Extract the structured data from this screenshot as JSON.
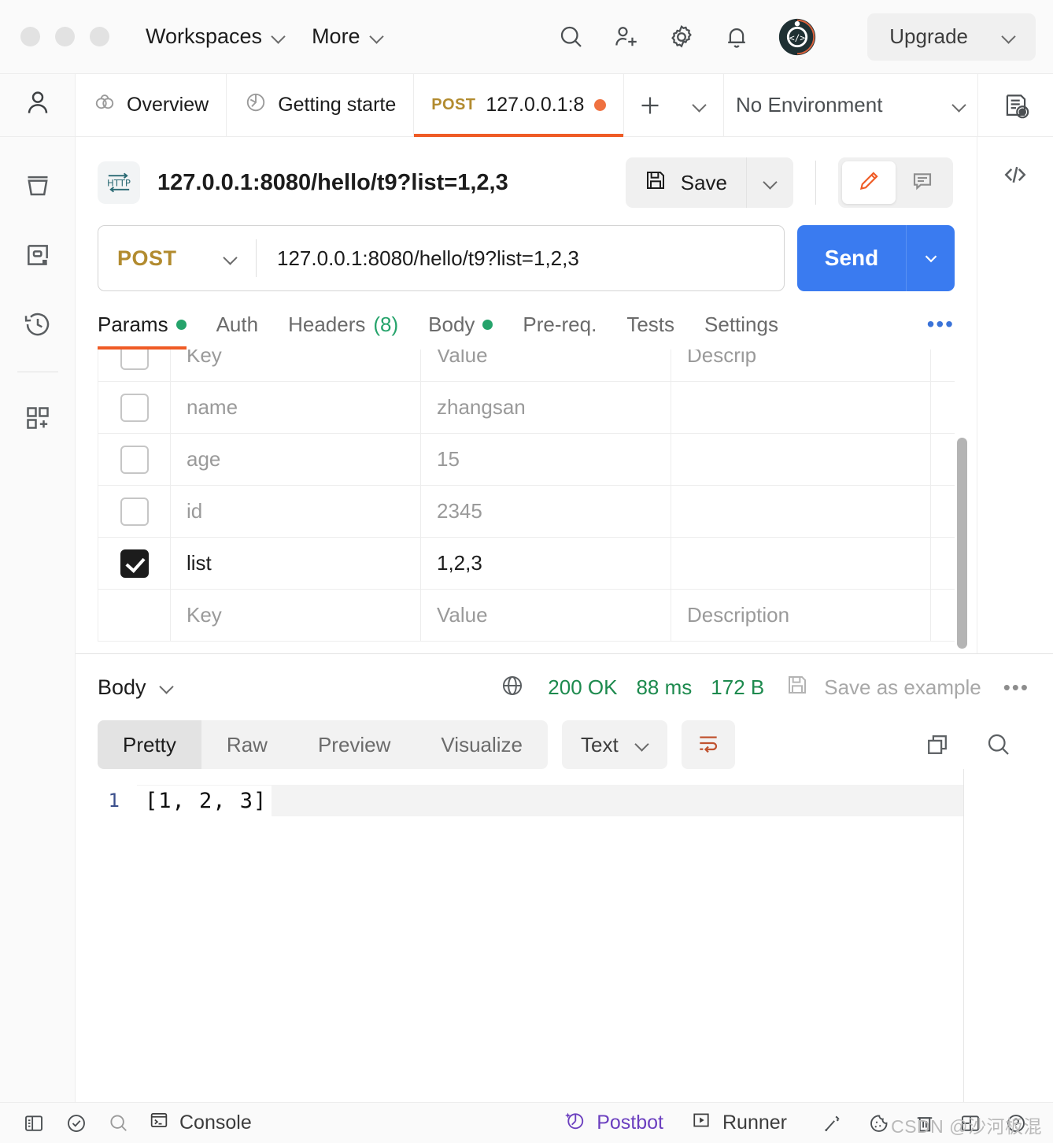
{
  "titlebar": {
    "workspaces_label": "Workspaces",
    "more_label": "More",
    "upgrade_label": "Upgrade",
    "icons": [
      "search-icon",
      "invite-user-icon",
      "settings-gear-icon",
      "notifications-bell-icon",
      "postman-logo-icon"
    ]
  },
  "sidebar": {
    "items": [
      {
        "name": "profile-avatar",
        "icon": "person-icon"
      },
      {
        "name": "collections",
        "icon": "collections-icon"
      },
      {
        "name": "apis",
        "icon": "api-box-icon"
      },
      {
        "name": "history",
        "icon": "history-clock-icon"
      },
      {
        "name": "new-module",
        "icon": "grid-plus-icon"
      }
    ]
  },
  "tabs": [
    {
      "label": "Overview",
      "icon": "overview-icon",
      "active": false
    },
    {
      "label": "Getting starte",
      "icon": "getting-started-icon",
      "active": false
    },
    {
      "label": "127.0.0.1:8",
      "method": "POST",
      "active": true,
      "unsaved": true
    }
  ],
  "tabbar": {
    "new_tab_label": "+",
    "environment": "No Environment",
    "env_icon": "environment-quick-look-icon"
  },
  "request": {
    "title": "127.0.0.1:8080/hello/t9?list=1,2,3",
    "protocol_badge": "HTTP",
    "save_label": "Save",
    "method": "POST",
    "url": "127.0.0.1:8080/hello/t9?list=1,2,3",
    "send_label": "Send",
    "edit_icon": "pencil-icon",
    "comment_icon": "comment-icon",
    "tabs": [
      {
        "label": "Params",
        "dot": true,
        "active": true
      },
      {
        "label": "Auth",
        "dot": false,
        "active": false
      },
      {
        "label": "Headers",
        "count": "(8)",
        "active": false
      },
      {
        "label": "Body",
        "dot": true,
        "active": false
      },
      {
        "label": "Pre-req.",
        "active": false
      },
      {
        "label": "Tests",
        "active": false
      },
      {
        "label": "Settings",
        "active": false
      }
    ]
  },
  "params": {
    "columns": [
      "Key",
      "Value",
      "Descrip"
    ],
    "placeholders": {
      "key": "Key",
      "value": "Value",
      "description": "Description"
    },
    "rows": [
      {
        "checked": false,
        "key": "name",
        "value": "zhangsan",
        "description": ""
      },
      {
        "checked": false,
        "key": "age",
        "value": "15",
        "description": ""
      },
      {
        "checked": false,
        "key": "id",
        "value": "2345",
        "description": ""
      },
      {
        "checked": true,
        "key": "list",
        "value": "1,2,3",
        "description": ""
      }
    ]
  },
  "response": {
    "body_label": "Body",
    "status": "200 OK",
    "time": "88 ms",
    "size": "172 B",
    "save_as_example": "Save as example",
    "format_tabs": [
      "Pretty",
      "Raw",
      "Preview",
      "Visualize"
    ],
    "active_format": "Pretty",
    "type_select": "Text",
    "wrap_icon": "wrap-lines-icon",
    "copy_icon": "copy-icon",
    "search_icon": "search-icon",
    "lines": [
      {
        "num": "1",
        "text": "[1, 2, 3]"
      }
    ]
  },
  "footer": {
    "console_label": "Console",
    "postbot_label": "Postbot",
    "runner_label": "Runner",
    "icons": [
      "sidebar-toggle-icon",
      "check-circle-icon",
      "search-icon",
      "console-icon",
      "network-icon",
      "cookies-icon",
      "trash-icon",
      "layout-icon",
      "help-icon"
    ],
    "watermark": "CSDN @沙河板混"
  },
  "colors": {
    "accent": "#ef5b25",
    "send": "#3a7bf0",
    "method": "#b28b2f",
    "success": "#1d8a4e",
    "postbot": "#6b3fbf"
  }
}
